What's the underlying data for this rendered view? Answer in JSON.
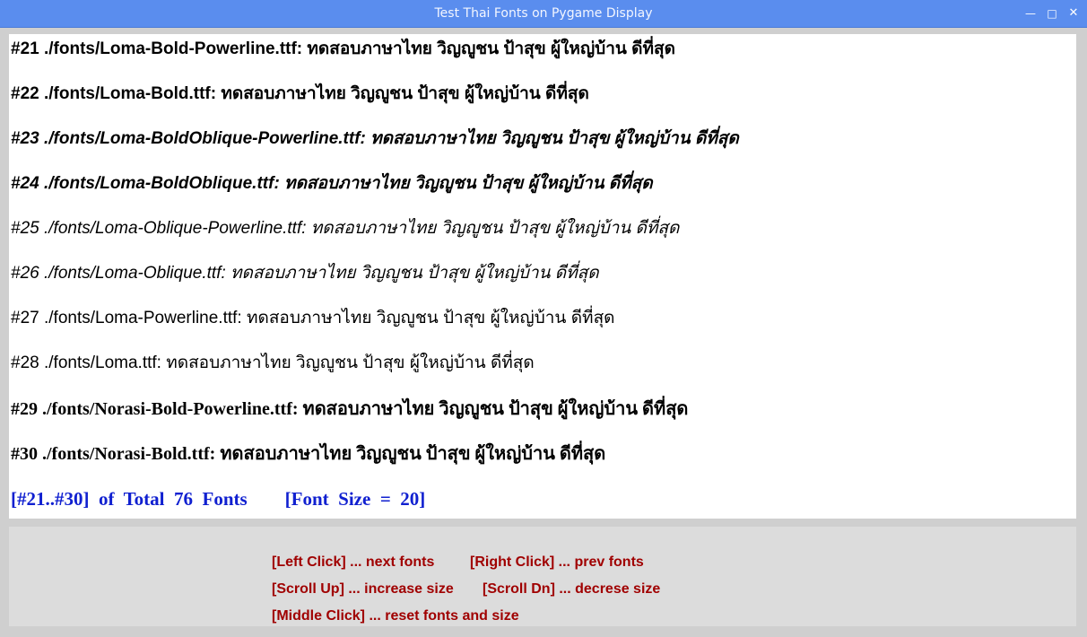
{
  "window": {
    "title": "Test Thai Fonts on Pygame Display",
    "minimize_glyph": "—",
    "maximize_glyph": "□",
    "close_glyph": "✕"
  },
  "font_lines": [
    {
      "text": "#21  ./fonts/Loma-Bold-Powerline.ttf:  ทดสอบภาษาไทย  วิญญูชน  ป้าสุข  ผู้ใหญ่บ้าน  ดีที่สุด"
    },
    {
      "text": "#22  ./fonts/Loma-Bold.ttf:  ทดสอบภาษาไทย  วิญญูชน  ป้าสุข  ผู้ใหญ่บ้าน  ดีที่สุด"
    },
    {
      "text": "#23  ./fonts/Loma-BoldOblique-Powerline.ttf:  ทดสอบภาษาไทย  วิญญูชน  ป้าสุข  ผู้ใหญ่บ้าน  ดีที่สุด"
    },
    {
      "text": "#24  ./fonts/Loma-BoldOblique.ttf:  ทดสอบภาษาไทย  วิญญูชน  ป้าสุข  ผู้ใหญ่บ้าน  ดีที่สุด"
    },
    {
      "text": "#25  ./fonts/Loma-Oblique-Powerline.ttf:  ทดสอบภาษาไทย  วิญญูชน  ป้าสุข  ผู้ใหญ่บ้าน  ดีที่สุด"
    },
    {
      "text": "#26  ./fonts/Loma-Oblique.ttf:  ทดสอบภาษาไทย  วิญญูชน  ป้าสุข  ผู้ใหญ่บ้าน  ดีที่สุด"
    },
    {
      "text": "#27  ./fonts/Loma-Powerline.ttf:  ทดสอบภาษาไทย  วิญญูชน  ป้าสุข  ผู้ใหญ่บ้าน  ดีที่สุด"
    },
    {
      "text": "#28  ./fonts/Loma.ttf:  ทดสอบภาษาไทย  วิญญูชน  ป้าสุข  ผู้ใหญ่บ้าน  ดีที่สุด"
    },
    {
      "text": "#29  ./fonts/Norasi-Bold-Powerline.ttf:  ทดสอบภาษาไทย  วิญญูชน  ป้าสุข  ผู้ใหญ่บ้าน  ดีที่สุด"
    },
    {
      "text": "#30  ./fonts/Norasi-Bold.ttf:  ทดสอบภาษาไทย  วิญญูชน  ป้าสุข  ผู้ใหญ่บ้าน  ดีที่สุด"
    }
  ],
  "summary": "[#21..#30]  of  Total  76  Fonts        [Font  Size  =  20]",
  "help": {
    "left_click": "[Left Click] ... next fonts",
    "right_click": "[Right Click] ... prev fonts",
    "scroll_up": "[Scroll Up] ... increase size",
    "scroll_dn": "[Scroll Dn] ... decrese size",
    "middle_click": "[Middle Click] ... reset fonts and size"
  },
  "colors": {
    "titlebar": "#5a8dee",
    "summary_text": "#1020d0",
    "help_text": "#a00000",
    "display_bg": "#ffffff",
    "panel_bg": "#dcdcdc"
  }
}
